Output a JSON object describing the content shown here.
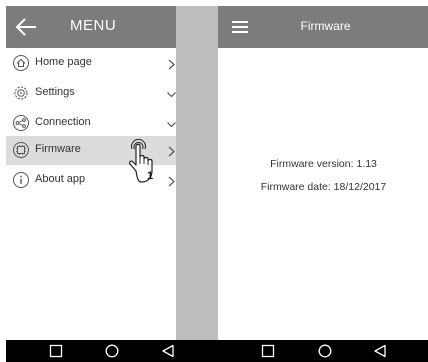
{
  "drawer": {
    "title": "MENU",
    "items": [
      {
        "label": "Home page",
        "icon": "home-icon",
        "arrow": "right"
      },
      {
        "label": "Settings",
        "icon": "settings-icon",
        "arrow": "down"
      },
      {
        "label": "Connection",
        "icon": "connection-icon",
        "arrow": "down"
      },
      {
        "label": "Firmware",
        "icon": "firmware-icon",
        "arrow": "right",
        "active": true
      },
      {
        "label": "About app",
        "icon": "info-icon",
        "arrow": "right"
      }
    ],
    "pointer_step": "1"
  },
  "firmware_page": {
    "title": "Firmware",
    "version_text": "Firmware version: 1.13",
    "date_text": "Firmware date: 18/12/2017"
  },
  "navbar": {
    "buttons": [
      "recent-apps",
      "home",
      "back"
    ]
  },
  "colors": {
    "header_bg": "#7c7c7c",
    "active_item_bg": "#dcdcdc",
    "scrim": "#bdbdbd",
    "navbar_bg": "#000000"
  }
}
